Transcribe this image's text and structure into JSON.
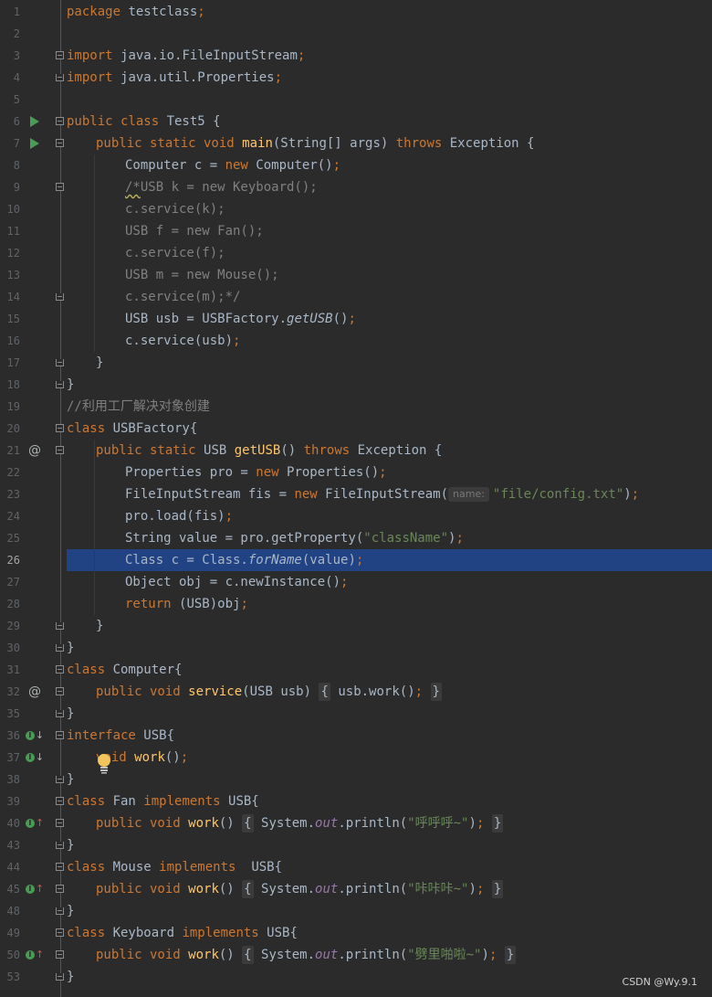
{
  "editor": {
    "lines": [
      {
        "num": "1",
        "tokens": [
          {
            "t": "package ",
            "c": "kw"
          },
          {
            "t": "testclass",
            "c": ""
          },
          {
            "t": ";",
            "c": "kw"
          }
        ]
      },
      {
        "num": "2",
        "tokens": []
      },
      {
        "num": "3",
        "fold": "start",
        "tokens": [
          {
            "t": "import ",
            "c": "kw"
          },
          {
            "t": "java.io.FileInputStream",
            "c": ""
          },
          {
            "t": ";",
            "c": "kw"
          }
        ]
      },
      {
        "num": "4",
        "fold": "end",
        "tokens": [
          {
            "t": "import ",
            "c": "kw"
          },
          {
            "t": "java.util.Properties",
            "c": ""
          },
          {
            "t": ";",
            "c": "kw"
          }
        ]
      },
      {
        "num": "5",
        "tokens": []
      },
      {
        "num": "6",
        "icon": "run",
        "fold": "start",
        "tokens": [
          {
            "t": "public class ",
            "c": "kw"
          },
          {
            "t": "Test5 {",
            "c": ""
          }
        ]
      },
      {
        "num": "7",
        "icon": "run",
        "fold": "start",
        "indent": 1,
        "tokens": [
          {
            "t": "public static void ",
            "c": "kw"
          },
          {
            "t": "main",
            "c": "fn"
          },
          {
            "t": "(String[] args) ",
            "c": ""
          },
          {
            "t": "throws ",
            "c": "kw"
          },
          {
            "t": "Exception {",
            "c": ""
          }
        ]
      },
      {
        "num": "8",
        "indent": 2,
        "tokens": [
          {
            "t": "Computer c = ",
            "c": ""
          },
          {
            "t": "new ",
            "c": "kw"
          },
          {
            "t": "Computer()",
            "c": ""
          },
          {
            "t": ";",
            "c": "kw"
          }
        ]
      },
      {
        "num": "9",
        "fold": "start",
        "indent": 2,
        "tokens": [
          {
            "t": "/*",
            "c": "com sq"
          },
          {
            "t": "USB k = new Keyboard();",
            "c": "com"
          }
        ]
      },
      {
        "num": "10",
        "indent": 2,
        "tokens": [
          {
            "t": "c.service(k);",
            "c": "com"
          }
        ]
      },
      {
        "num": "11",
        "indent": 2,
        "tokens": [
          {
            "t": "USB f = new Fan();",
            "c": "com"
          }
        ]
      },
      {
        "num": "12",
        "indent": 2,
        "tokens": [
          {
            "t": "c.service(f);",
            "c": "com"
          }
        ]
      },
      {
        "num": "13",
        "indent": 2,
        "tokens": [
          {
            "t": "USB m = new Mouse();",
            "c": "com"
          }
        ]
      },
      {
        "num": "14",
        "fold": "end",
        "indent": 2,
        "tokens": [
          {
            "t": "c.service(m);*/",
            "c": "com"
          }
        ]
      },
      {
        "num": "15",
        "indent": 2,
        "tokens": [
          {
            "t": "USB usb = USBFactory.",
            "c": ""
          },
          {
            "t": "getUSB",
            "c": "si"
          },
          {
            "t": "()",
            "c": ""
          },
          {
            "t": ";",
            "c": "kw"
          }
        ]
      },
      {
        "num": "16",
        "indent": 2,
        "tokens": [
          {
            "t": "c.service(usb)",
            "c": ""
          },
          {
            "t": ";",
            "c": "kw"
          }
        ]
      },
      {
        "num": "17",
        "fold": "end",
        "indent": 1,
        "tokens": [
          {
            "t": "}",
            "c": ""
          }
        ]
      },
      {
        "num": "18",
        "fold": "end",
        "tokens": [
          {
            "t": "}",
            "c": ""
          }
        ]
      },
      {
        "num": "19",
        "tokens": [
          {
            "t": "//利用工厂解决对象创建",
            "c": "com"
          }
        ]
      },
      {
        "num": "20",
        "fold": "start",
        "tokens": [
          {
            "t": "class ",
            "c": "kw"
          },
          {
            "t": "USBFactory{",
            "c": ""
          }
        ]
      },
      {
        "num": "21",
        "icon": "at",
        "fold": "start",
        "indent": 1,
        "tokens": [
          {
            "t": "public static ",
            "c": "kw"
          },
          {
            "t": "USB ",
            "c": ""
          },
          {
            "t": "getUSB",
            "c": "fn"
          },
          {
            "t": "() ",
            "c": ""
          },
          {
            "t": "throws ",
            "c": "kw"
          },
          {
            "t": "Exception {",
            "c": ""
          }
        ]
      },
      {
        "num": "22",
        "indent": 2,
        "tokens": [
          {
            "t": "Properties pro = ",
            "c": ""
          },
          {
            "t": "new ",
            "c": "kw"
          },
          {
            "t": "Properties()",
            "c": ""
          },
          {
            "t": ";",
            "c": "kw"
          }
        ]
      },
      {
        "num": "23",
        "indent": 2,
        "tokens": [
          {
            "t": "FileInputStream fis = ",
            "c": ""
          },
          {
            "t": "new ",
            "c": "kw"
          },
          {
            "t": "FileInputStream(",
            "c": ""
          },
          {
            "t": "name:",
            "c": "hint"
          },
          {
            "t": "\"file/config.txt\"",
            "c": "str"
          },
          {
            "t": ")",
            "c": ""
          },
          {
            "t": ";",
            "c": "kw"
          }
        ]
      },
      {
        "num": "24",
        "indent": 2,
        "tokens": [
          {
            "t": "pro.load(fis)",
            "c": ""
          },
          {
            "t": ";",
            "c": "kw"
          }
        ]
      },
      {
        "num": "25",
        "indent": 2,
        "tokens": [
          {
            "t": "String value = pro.getProperty(",
            "c": ""
          },
          {
            "t": "\"className\"",
            "c": "str"
          },
          {
            "t": ")",
            "c": ""
          },
          {
            "t": ";",
            "c": "kw"
          }
        ]
      },
      {
        "num": "26",
        "current": true,
        "indent": 2,
        "tokens": [
          {
            "t": "Class c = Class.",
            "c": ""
          },
          {
            "t": "forName",
            "c": "si"
          },
          {
            "t": "(value)",
            "c": ""
          },
          {
            "t": ";",
            "c": "kw"
          }
        ]
      },
      {
        "num": "27",
        "indent": 2,
        "tokens": [
          {
            "t": "Object obj = c.newInstance()",
            "c": ""
          },
          {
            "t": ";",
            "c": "kw"
          }
        ]
      },
      {
        "num": "28",
        "indent": 2,
        "tokens": [
          {
            "t": "return ",
            "c": "kw"
          },
          {
            "t": "(USB)obj",
            "c": ""
          },
          {
            "t": ";",
            "c": "kw"
          }
        ]
      },
      {
        "num": "29",
        "fold": "end",
        "indent": 1,
        "tokens": [
          {
            "t": "}",
            "c": ""
          }
        ]
      },
      {
        "num": "30",
        "fold": "end",
        "tokens": [
          {
            "t": "}",
            "c": ""
          }
        ]
      },
      {
        "num": "31",
        "fold": "start",
        "tokens": [
          {
            "t": "class ",
            "c": "kw"
          },
          {
            "t": "Computer{",
            "c": ""
          }
        ]
      },
      {
        "num": "32",
        "icon": "at",
        "fold": "folded",
        "indent": 1,
        "tokens": [
          {
            "t": "public void ",
            "c": "kw"
          },
          {
            "t": "service",
            "c": "fn"
          },
          {
            "t": "(USB usb) ",
            "c": ""
          },
          {
            "t": "{",
            "c": "box"
          },
          {
            "t": " usb.work()",
            "c": ""
          },
          {
            "t": ";",
            "c": "kw"
          },
          {
            "t": " ",
            "c": ""
          },
          {
            "t": "}",
            "c": "box"
          }
        ]
      },
      {
        "num": "35",
        "fold": "end",
        "tokens": [
          {
            "t": "}",
            "c": ""
          }
        ]
      },
      {
        "num": "36",
        "icon": "impl-down",
        "fold": "start",
        "tokens": [
          {
            "t": "interface ",
            "c": "kw"
          },
          {
            "t": "USB{",
            "c": ""
          }
        ]
      },
      {
        "num": "37",
        "icon": "impl-down",
        "indent": 1,
        "tokens": [
          {
            "t": "void ",
            "c": "kw"
          },
          {
            "t": "work",
            "c": "fn"
          },
          {
            "t": "()",
            "c": ""
          },
          {
            "t": ";",
            "c": "kw"
          }
        ]
      },
      {
        "num": "38",
        "fold": "end",
        "tokens": [
          {
            "t": "}",
            "c": ""
          }
        ]
      },
      {
        "num": "39",
        "fold": "start",
        "tokens": [
          {
            "t": "class ",
            "c": "kw"
          },
          {
            "t": "Fan ",
            "c": ""
          },
          {
            "t": "implements ",
            "c": "kw"
          },
          {
            "t": "USB{",
            "c": ""
          }
        ]
      },
      {
        "num": "40",
        "icon": "impl-up",
        "fold": "folded",
        "indent": 1,
        "tokens": [
          {
            "t": "public void ",
            "c": "kw"
          },
          {
            "t": "work",
            "c": "fn"
          },
          {
            "t": "() ",
            "c": ""
          },
          {
            "t": "{",
            "c": "box"
          },
          {
            "t": " System.",
            "c": ""
          },
          {
            "t": "out",
            "c": "st"
          },
          {
            "t": ".println(",
            "c": ""
          },
          {
            "t": "\"呼呼呼~\"",
            "c": "str"
          },
          {
            "t": ")",
            "c": ""
          },
          {
            "t": ";",
            "c": "kw"
          },
          {
            "t": " ",
            "c": ""
          },
          {
            "t": "}",
            "c": "box"
          }
        ]
      },
      {
        "num": "43",
        "fold": "end",
        "tokens": [
          {
            "t": "}",
            "c": ""
          }
        ]
      },
      {
        "num": "44",
        "fold": "start",
        "tokens": [
          {
            "t": "class ",
            "c": "kw"
          },
          {
            "t": "Mouse ",
            "c": ""
          },
          {
            "t": "implements  ",
            "c": "kw"
          },
          {
            "t": "USB{",
            "c": ""
          }
        ]
      },
      {
        "num": "45",
        "icon": "impl-up",
        "fold": "folded",
        "indent": 1,
        "tokens": [
          {
            "t": "public void ",
            "c": "kw"
          },
          {
            "t": "work",
            "c": "fn"
          },
          {
            "t": "() ",
            "c": ""
          },
          {
            "t": "{",
            "c": "box"
          },
          {
            "t": " System.",
            "c": ""
          },
          {
            "t": "out",
            "c": "st"
          },
          {
            "t": ".println(",
            "c": ""
          },
          {
            "t": "\"咔咔咔~\"",
            "c": "str"
          },
          {
            "t": ")",
            "c": ""
          },
          {
            "t": ";",
            "c": "kw"
          },
          {
            "t": " ",
            "c": ""
          },
          {
            "t": "}",
            "c": "box"
          }
        ]
      },
      {
        "num": "48",
        "fold": "end",
        "tokens": [
          {
            "t": "}",
            "c": ""
          }
        ]
      },
      {
        "num": "49",
        "fold": "start",
        "tokens": [
          {
            "t": "class ",
            "c": "kw"
          },
          {
            "t": "Keyboard ",
            "c": ""
          },
          {
            "t": "implements ",
            "c": "kw"
          },
          {
            "t": "USB{",
            "c": ""
          }
        ]
      },
      {
        "num": "50",
        "icon": "impl-up",
        "fold": "folded",
        "indent": 1,
        "tokens": [
          {
            "t": "public void ",
            "c": "kw"
          },
          {
            "t": "work",
            "c": "fn"
          },
          {
            "t": "() ",
            "c": ""
          },
          {
            "t": "{",
            "c": "box"
          },
          {
            "t": " System.",
            "c": ""
          },
          {
            "t": "out",
            "c": "st"
          },
          {
            "t": ".println(",
            "c": ""
          },
          {
            "t": "\"劈里啪啦~\"",
            "c": "str"
          },
          {
            "t": ")",
            "c": ""
          },
          {
            "t": ";",
            "c": "kw"
          },
          {
            "t": " ",
            "c": ""
          },
          {
            "t": "}",
            "c": "box"
          }
        ]
      },
      {
        "num": "53",
        "fold": "end",
        "tokens": [
          {
            "t": "}",
            "c": ""
          }
        ]
      }
    ]
  },
  "icons": {
    "run": "run-gutter-icon",
    "at": "override-at-icon",
    "impl_down": "implemented-down-icon",
    "impl_up": "implements-up-icon",
    "bulb": "lightbulb-icon"
  },
  "watermark": "CSDN @Wy.9.1",
  "colors": {
    "background": "#2b2b2b",
    "keyword": "#cc7832",
    "function": "#ffc66d",
    "string": "#6a8759",
    "comment": "#808080",
    "static_field": "#9876aa",
    "selection": "#214283",
    "text": "#a9b7c6"
  }
}
